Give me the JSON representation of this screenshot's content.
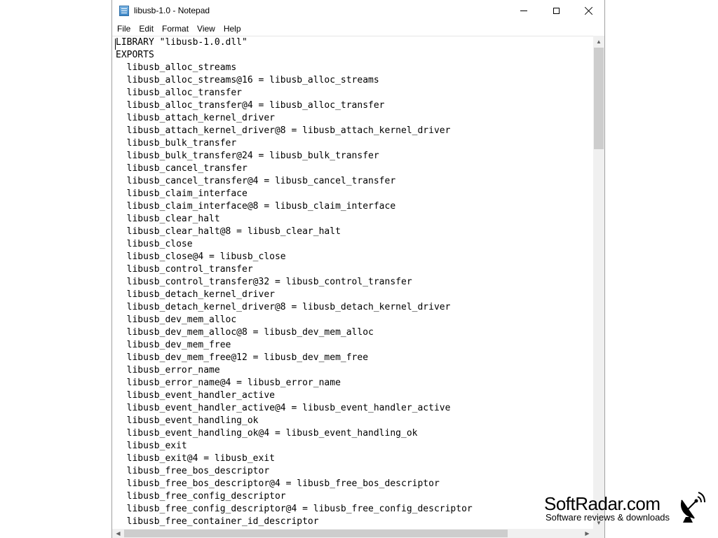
{
  "window": {
    "title": "libusb-1.0 - Notepad",
    "icon": "notepad-icon"
  },
  "menu": {
    "items": [
      "File",
      "Edit",
      "Format",
      "View",
      "Help"
    ]
  },
  "editor": {
    "lines": [
      "LIBRARY \"libusb-1.0.dll\"",
      "EXPORTS",
      "  libusb_alloc_streams",
      "  libusb_alloc_streams@16 = libusb_alloc_streams",
      "  libusb_alloc_transfer",
      "  libusb_alloc_transfer@4 = libusb_alloc_transfer",
      "  libusb_attach_kernel_driver",
      "  libusb_attach_kernel_driver@8 = libusb_attach_kernel_driver",
      "  libusb_bulk_transfer",
      "  libusb_bulk_transfer@24 = libusb_bulk_transfer",
      "  libusb_cancel_transfer",
      "  libusb_cancel_transfer@4 = libusb_cancel_transfer",
      "  libusb_claim_interface",
      "  libusb_claim_interface@8 = libusb_claim_interface",
      "  libusb_clear_halt",
      "  libusb_clear_halt@8 = libusb_clear_halt",
      "  libusb_close",
      "  libusb_close@4 = libusb_close",
      "  libusb_control_transfer",
      "  libusb_control_transfer@32 = libusb_control_transfer",
      "  libusb_detach_kernel_driver",
      "  libusb_detach_kernel_driver@8 = libusb_detach_kernel_driver",
      "  libusb_dev_mem_alloc",
      "  libusb_dev_mem_alloc@8 = libusb_dev_mem_alloc",
      "  libusb_dev_mem_free",
      "  libusb_dev_mem_free@12 = libusb_dev_mem_free",
      "  libusb_error_name",
      "  libusb_error_name@4 = libusb_error_name",
      "  libusb_event_handler_active",
      "  libusb_event_handler_active@4 = libusb_event_handler_active",
      "  libusb_event_handling_ok",
      "  libusb_event_handling_ok@4 = libusb_event_handling_ok",
      "  libusb_exit",
      "  libusb_exit@4 = libusb_exit",
      "  libusb_free_bos_descriptor",
      "  libusb_free_bos_descriptor@4 = libusb_free_bos_descriptor",
      "  libusb_free_config_descriptor",
      "  libusb_free_config_descriptor@4 = libusb_free_config_descriptor",
      "  libusb_free_container_id_descriptor"
    ]
  },
  "watermark": {
    "name": "SoftRadar.com",
    "tagline": "Software reviews & downloads"
  },
  "colors": {
    "scrollbar_track": "#f0f0f0",
    "scrollbar_thumb": "#cdcdcd",
    "border": "#a0a0a0"
  }
}
